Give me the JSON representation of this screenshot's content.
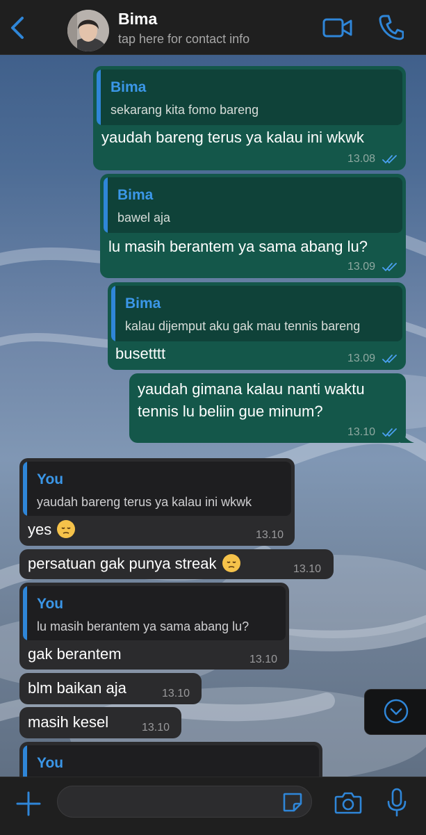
{
  "header": {
    "contact_name": "Bima",
    "subtitle": "tap here for contact info"
  },
  "messages": [
    {
      "dir": "out",
      "quote_author": "Bima",
      "quote_text": "sekarang kita fomo bareng",
      "text": "yaudah bareng terus ya kalau ini wkwk",
      "time": "13.08"
    },
    {
      "dir": "out",
      "quote_author": "Bima",
      "quote_text": "bawel aja",
      "text": "lu masih berantem ya sama abang lu?",
      "time": "13.09"
    },
    {
      "dir": "out",
      "quote_author": "Bima",
      "quote_text": "kalau dijemput aku gak mau tennis bareng",
      "text": "busetttt",
      "time": "13.09"
    },
    {
      "dir": "out",
      "text_line1": "yaudah gimana kalau nanti waktu",
      "text_line2": "tennis lu beliin gue minum?",
      "time": "13.10"
    },
    {
      "dir": "in",
      "quote_author": "You",
      "quote_text": "yaudah bareng terus ya kalau ini wkwk",
      "text": "yes",
      "time": "13.10"
    },
    {
      "dir": "in",
      "text": "persatuan gak punya streak",
      "time": "13.10"
    },
    {
      "dir": "in",
      "quote_author": "You",
      "quote_text": "lu masih berantem ya sama abang lu?",
      "text": "gak berantem",
      "time": "13.10"
    },
    {
      "dir": "in",
      "text": "blm baikan aja",
      "time": "13.10"
    },
    {
      "dir": "in",
      "text": "masih kesel",
      "time": "13.10"
    },
    {
      "dir": "in",
      "quote_author": "You"
    }
  ],
  "icons": {
    "back": "chevron-left-icon",
    "video": "video-camera-icon",
    "call": "phone-icon",
    "scroll": "chevron-down-circle-icon",
    "plus": "plus-icon",
    "sticker": "sticker-icon",
    "camera": "camera-icon",
    "mic": "microphone-icon"
  },
  "colors": {
    "accent": "#2f86d8",
    "outgoing_bubble": "#14574a",
    "incoming_bubble": "#2b2b2d",
    "bar_background": "#1f1f1f"
  }
}
